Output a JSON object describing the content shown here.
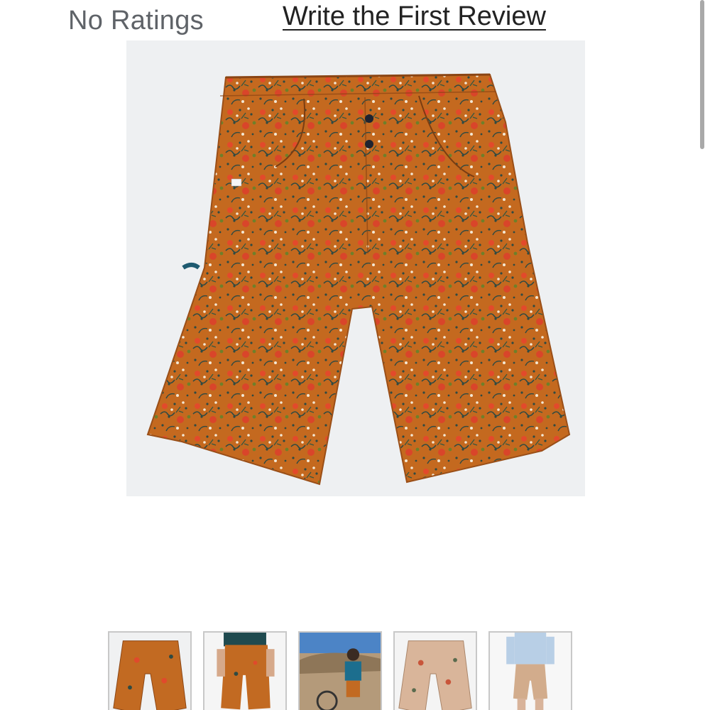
{
  "reviews": {
    "ratings_text": "No Ratings",
    "write_review_label": "Write the First Review"
  },
  "product_image": {
    "icon": "orange-floral-shorts-photo",
    "colors": {
      "fabric": "#c4691f",
      "background": "#eef0f2"
    }
  },
  "thumbnails": [
    {
      "icon": "orange-floral-shorts-thumb",
      "selected": true
    },
    {
      "icon": "model-wearing-shorts-thumb"
    },
    {
      "icon": "rider-outdoor-thumb"
    },
    {
      "icon": "tan-floral-shorts-thumb"
    },
    {
      "icon": "model-light-shirt-thumb"
    }
  ]
}
